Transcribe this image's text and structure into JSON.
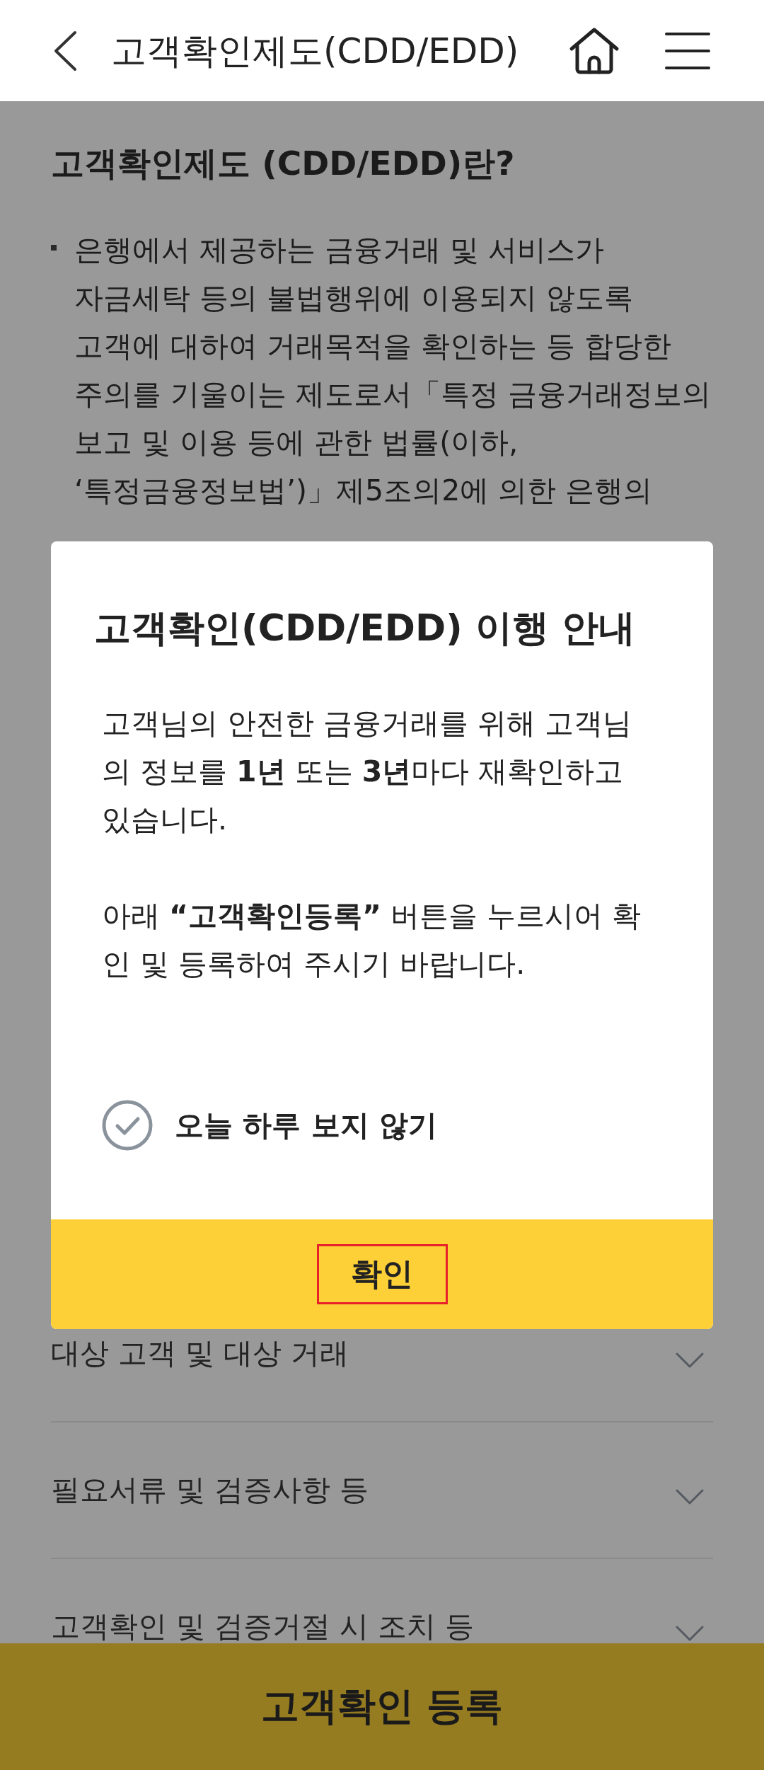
{
  "header": {
    "title": "고객확인제도(CDD/EDD)"
  },
  "intro": {
    "heading": "고객확인제도 (CDD/EDD)란?",
    "bullets": [
      "은행에서 제공하는 금융거래 및 서비스가 자금세탁 등의 불법행위에 이용되지 않도록 고객에 대하여 거래목적을 확인하는 등 합당한 주의를 기울이는 제도로서「특정 금융거래정보의 보고 및 이용 등에 관한 법률(이하, ‘특정금융정보법’)」제5조의2에 의한 은행의"
    ]
  },
  "dialog": {
    "title": "고객확인(CDD/EDD) 이행 안내",
    "paragraphs": [
      "고객님의 안전한 금융거래를 위해 고객님의 정보를 **1년** 또는 **3년**마다 재확인하고 있습니다.",
      "아래 **“고객확인등록”** 버튼을 누르시어 확인 및 등록하여 주시기 바랍니다."
    ],
    "dont_show_today": {
      "label": "오늘 하루 보지 않기",
      "checked": false
    },
    "confirm_button": {
      "label": "확인",
      "highlighted": true
    }
  },
  "accordion": [
    {
      "label": "대상 고객 및 대상 거래",
      "expanded": false
    },
    {
      "label": "필요서류 및 검증사항 등",
      "expanded": false
    },
    {
      "label": "고객확인 및 검증거절 시 조치 등",
      "expanded": false
    }
  ],
  "register_button": {
    "label": "고객확인 등록"
  }
}
